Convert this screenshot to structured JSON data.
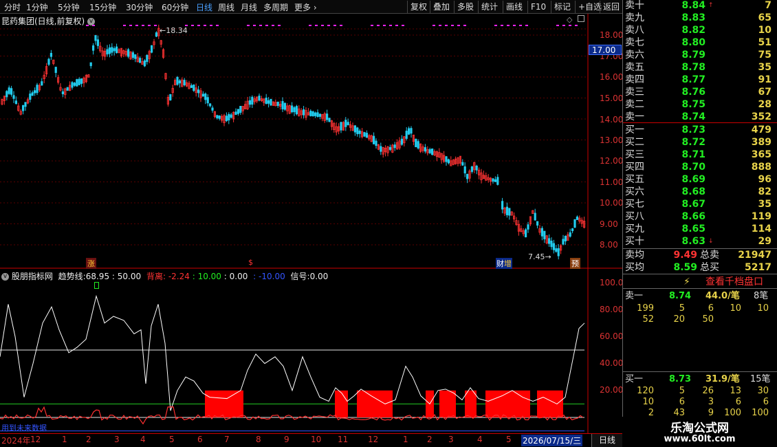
{
  "toolbar": {
    "left_items": [
      "分时",
      "1分钟",
      "5分钟",
      "15分钟",
      "30分钟",
      "60分钟",
      "日线",
      "周线",
      "月线",
      "多周期",
      "更多"
    ],
    "active_item": "日线",
    "right_items": [
      "复权",
      "叠加",
      "多股",
      "统计",
      "画线",
      "F10",
      "标记",
      "+自选",
      "返回"
    ]
  },
  "stock_title": "昆药集团(日线,前复权)",
  "price_axis": [
    "18.00",
    "17.00",
    "16.00",
    "15.00",
    "14.00",
    "13.00",
    "12.00",
    "11.00",
    "10.00",
    "9.00",
    "8.00"
  ],
  "highlighted_price": "17.00",
  "annotations": {
    "high": "18.34",
    "low": "7.45"
  },
  "event_markers": [
    "涨",
    "$",
    "财",
    "预"
  ],
  "event_marker_extra": "增",
  "indicator": {
    "name": "股朋指标网",
    "trend_label": "趋势线:",
    "trend_value": "68.95",
    "v1": ": 50.00",
    "divergence_label": "背离:",
    "div_value": "-2.24",
    "v2": ": 10.00",
    "v3": ": 0.00",
    "v4": ": -10.00",
    "signal_label": "信号:",
    "signal_value": "0.00",
    "axis": [
      "100.00",
      "80.00",
      "60.00",
      "40.00",
      "20.00"
    ],
    "future_note": "用到未来数据"
  },
  "date_axis": {
    "labels": [
      "2024年",
      "12",
      "1",
      "2",
      "3",
      "4",
      "5",
      "6",
      "7",
      "8",
      "9",
      "10",
      "11",
      "12",
      "1",
      "2",
      "3",
      "4",
      "5",
      "2026/07/15/三"
    ],
    "period_tab": "日线"
  },
  "order_book": {
    "asks": [
      {
        "label": "卖十",
        "price": "8.84",
        "vol": "7"
      },
      {
        "label": "卖九",
        "price": "8.83",
        "vol": "65"
      },
      {
        "label": "卖八",
        "price": "8.82",
        "vol": "10"
      },
      {
        "label": "卖七",
        "price": "8.80",
        "vol": "51"
      },
      {
        "label": "卖六",
        "price": "8.79",
        "vol": "75"
      },
      {
        "label": "卖五",
        "price": "8.78",
        "vol": "35"
      },
      {
        "label": "卖四",
        "price": "8.77",
        "vol": "91"
      },
      {
        "label": "卖三",
        "price": "8.76",
        "vol": "67"
      },
      {
        "label": "卖二",
        "price": "8.75",
        "vol": "28"
      },
      {
        "label": "卖一",
        "price": "8.74",
        "vol": "352"
      }
    ],
    "bids": [
      {
        "label": "买一",
        "price": "8.73",
        "vol": "479"
      },
      {
        "label": "买二",
        "price": "8.72",
        "vol": "389"
      },
      {
        "label": "买三",
        "price": "8.71",
        "vol": "365"
      },
      {
        "label": "买四",
        "price": "8.70",
        "vol": "888"
      },
      {
        "label": "买五",
        "price": "8.69",
        "vol": "96"
      },
      {
        "label": "买六",
        "price": "8.68",
        "vol": "82"
      },
      {
        "label": "买七",
        "price": "8.67",
        "vol": "35"
      },
      {
        "label": "买八",
        "price": "8.66",
        "vol": "119"
      },
      {
        "label": "买九",
        "price": "8.65",
        "vol": "114"
      },
      {
        "label": "买十",
        "price": "8.63",
        "vol": "29"
      }
    ],
    "summary": {
      "sell_avg_label": "卖均",
      "sell_avg": "9.49",
      "total_sell_label": "总卖",
      "total_sell": "21947",
      "buy_avg_label": "买均",
      "buy_avg": "8.59",
      "total_buy_label": "总买",
      "total_buy": "5217"
    },
    "button": "查看千档盘口",
    "sell_detail": {
      "label": "卖一",
      "price": "8.74",
      "per": "44.0/笔",
      "count": "8笔",
      "rows": [
        [
          "199",
          "5",
          "6",
          "10",
          "10"
        ],
        [
          "52",
          "20",
          "50"
        ]
      ]
    },
    "buy_detail": {
      "label": "买一",
      "price": "8.73",
      "per": "31.9/笔",
      "count": "15笔",
      "rows": [
        [
          "120",
          "5",
          "26",
          "13",
          "30"
        ],
        [
          "10",
          "6",
          "3",
          "6",
          "6"
        ],
        [
          "2",
          "43",
          "9",
          "100",
          "100"
        ]
      ]
    }
  },
  "logo": {
    "name": "乐淘公式网",
    "url": "www.60lt.com"
  },
  "colors": {
    "up": "#ff3333",
    "down": "#22ccee",
    "trend": "#ffffff",
    "divergence": "#ff3030",
    "bar": "#ff0000"
  }
}
